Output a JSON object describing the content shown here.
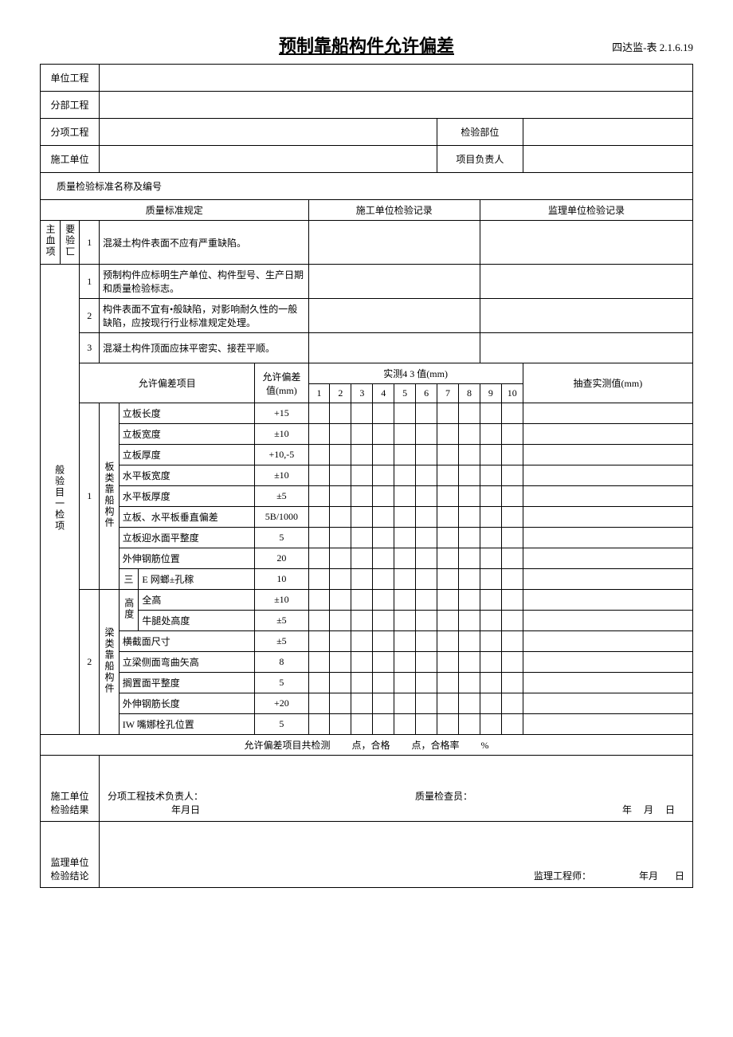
{
  "doc_code": "四达监-表 2.1.6.19",
  "title": "预制靠船构件允许偏差",
  "labels": {
    "unit_project": "单位工程",
    "sub_project": "分部工程",
    "item_project": "分项工程",
    "inspect_part": "检验部位",
    "construction_unit": "施工单位",
    "project_leader": "项目负责人",
    "standard_name": "质量检验标准名称及编号",
    "quality_standard": "质量标准规定",
    "construction_record": "施工单位检验记录",
    "supervision_record": "监理单位检验记录",
    "main_item": "主血项",
    "key_check": "要验匸",
    "general_item": "般验目一检项",
    "deviation_item": "允许偏差项目",
    "deviation_value": "允许偏差值(mm)",
    "measured_header": "实测4  3 值(mm)",
    "sample_value": "抽查实测值(mm)",
    "board_type": "板类靠船构件",
    "beam_type": "梁类靠船构件",
    "three": "三",
    "height_word": "高度",
    "summary_prefix": "允许偏差项目共检测",
    "summary_point": "点，合格",
    "summary_rate": "点，合格率",
    "percent": "%",
    "construction_result": "施工单位检验结果",
    "tech_leader": "分项工程技术负责人：",
    "quality_checker": "质量检查员：",
    "date_cn": "年月日",
    "year": "年",
    "month": "月",
    "day": "日",
    "supervision_conclusion": "监理单位检验结论",
    "supervision_engineer": "监理工程师："
  },
  "nums": [
    "1",
    "2",
    "3",
    "4",
    "5",
    "6",
    "7",
    "8",
    "9",
    "10"
  ],
  "main_items": [
    {
      "no": "1",
      "text": "混凝土构件表面不应有严重缺陷。"
    }
  ],
  "general_desc": [
    {
      "no": "1",
      "text": "预制构件应标明生产单位、构件型号、生产日期和质量检验标志。"
    },
    {
      "no": "2",
      "text": "构件表面不宜有•般缺陷，对影响耐久性的一般缺陷，应按现行行业标准规定处理。"
    },
    {
      "no": "3",
      "text": "混凝土构件顶面应抹平密实、接茬平顺。"
    }
  ],
  "board_rows": [
    {
      "name": "立板长度",
      "val": "+15"
    },
    {
      "name": "立板宽度",
      "val": "±10"
    },
    {
      "name": "立板厚度",
      "val": "+10,-5"
    },
    {
      "name": "水平板宽度",
      "val": "±10"
    },
    {
      "name": "水平板厚度",
      "val": "±5"
    },
    {
      "name": "立板、水平板垂直偏差",
      "val": "5B/1000"
    },
    {
      "name": "立板迎水面平整度",
      "val": "5"
    },
    {
      "name": "外伸钢筋位置",
      "val": "20"
    },
    {
      "name": "E 网螂±孔稼",
      "val": "10"
    }
  ],
  "beam_rows": [
    {
      "name": "全高",
      "val": "±10"
    },
    {
      "name": "牛腿处高度",
      "val": "±5"
    },
    {
      "name": "横截面尺寸",
      "val": "±5"
    },
    {
      "name": "立梁侧面弯曲矢高",
      "val": "8"
    },
    {
      "name": "搁置面平整度",
      "val": "5"
    },
    {
      "name": "外伸钢筋长度",
      "val": "+20"
    },
    {
      "name": "IW 嘴娜栓孔位置",
      "val": "5"
    }
  ]
}
